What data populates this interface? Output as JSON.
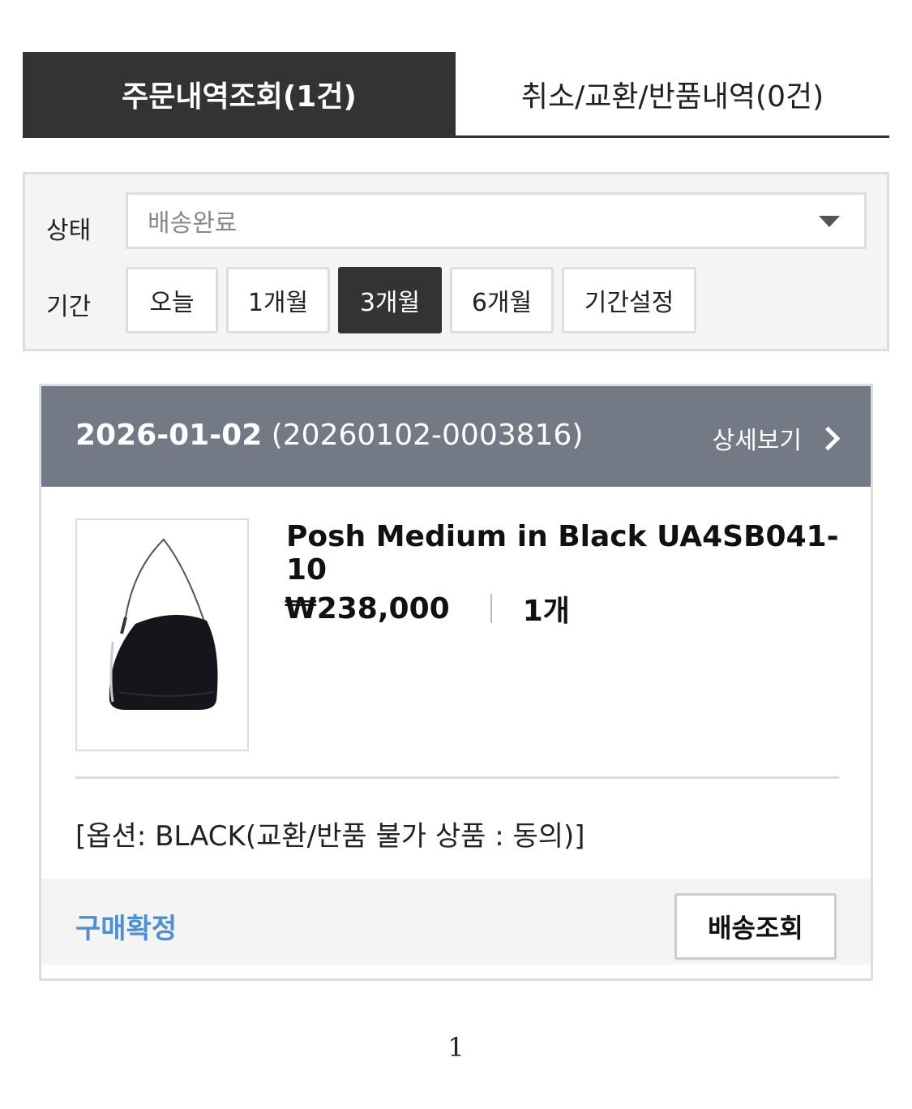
{
  "tabs": {
    "orders_label": "주문내역조회(1건)",
    "returns_label": "취소/교환/반품내역(0건)"
  },
  "filter": {
    "status_label": "상태",
    "status_value": "배송완료",
    "period_label": "기간",
    "periods": [
      "오늘",
      "1개월",
      "3개월",
      "6개월",
      "기간설정"
    ],
    "active_period": "3개월"
  },
  "order": {
    "date": "2026-01-02",
    "order_no": "(20260102-0003816)",
    "detail_label": "상세보기",
    "product_name": "Posh Medium in Black UA4SB041-10",
    "price": "₩238,000",
    "quantity": "1개",
    "option": "[옵션: BLACK(교환/반품 불가 상품 : 동의)]",
    "confirm_label": "구매확정",
    "track_label": "배송조회"
  },
  "pagination": {
    "current": "1"
  },
  "colors": {
    "dark": "#333333",
    "header_gray": "#737985",
    "link_blue": "#4a8fd8",
    "border": "#dddddd"
  }
}
